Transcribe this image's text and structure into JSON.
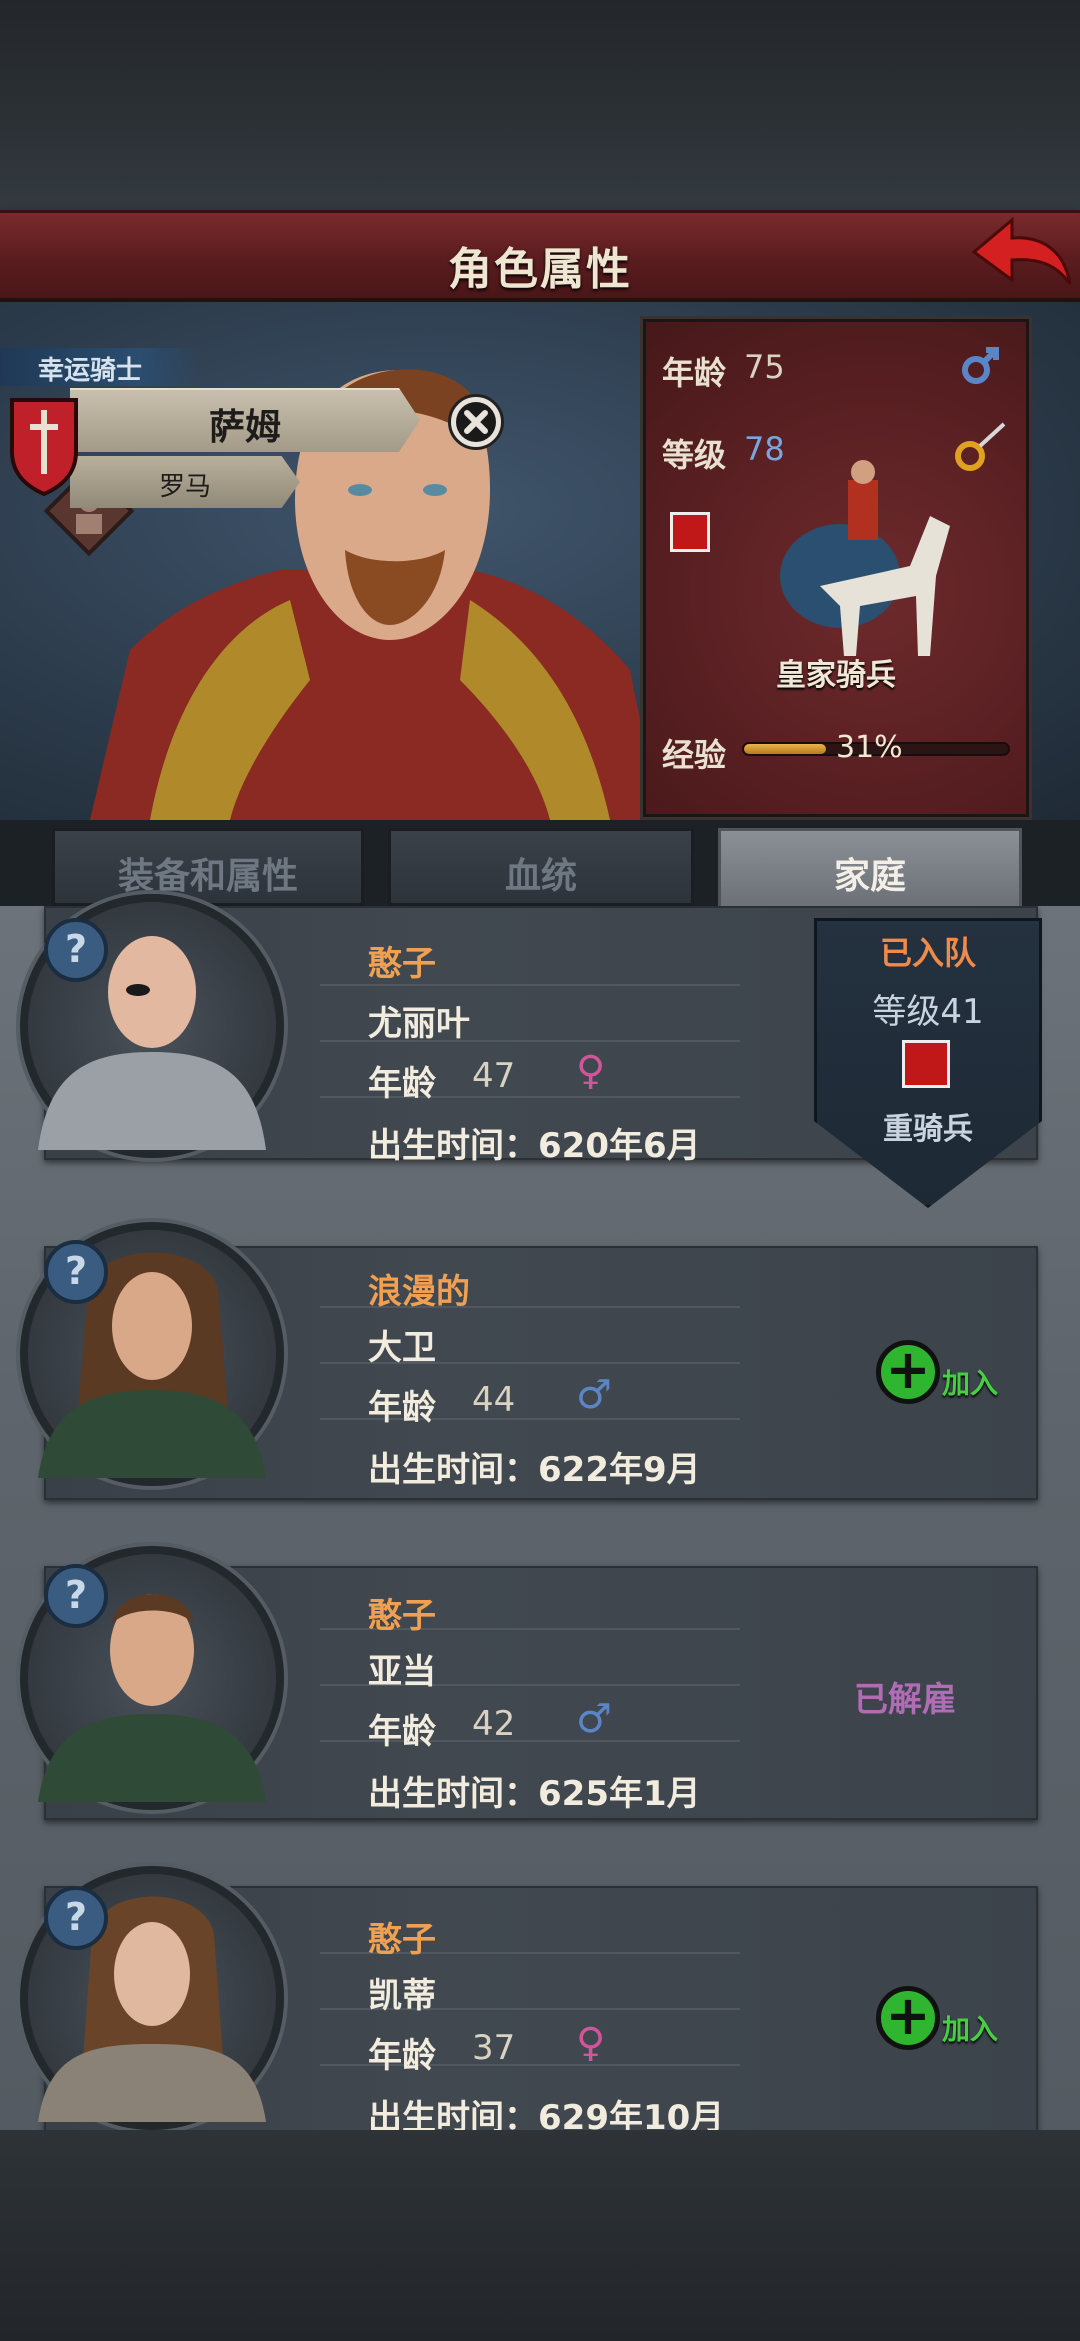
{
  "screen": {
    "title": "角色属性"
  },
  "hero": {
    "rank": "幸运骑士",
    "name": "萨姆",
    "origin": "罗马",
    "age_label": "年龄",
    "age": "75",
    "gender_icon": "male-icon",
    "level_label": "等级",
    "level": "78",
    "mount": "皇家骑兵",
    "exp_label": "经验",
    "exp_percent": "31%",
    "exp_fraction": 0.31
  },
  "tabs": [
    {
      "label": "装备和属性",
      "active": false
    },
    {
      "label": "血统",
      "active": false
    },
    {
      "label": "家庭",
      "active": true
    }
  ],
  "family": [
    {
      "trait": "憨子",
      "name": "尤丽叶",
      "age_label": "年龄",
      "age": "47",
      "gender": "♀",
      "birth": "出生时间：620年6月"
    },
    {
      "trait": "浪漫的",
      "name": "大卫",
      "age_label": "年龄",
      "age": "44",
      "gender": "♂",
      "birth": "出生时间：622年9月",
      "action": "加入"
    },
    {
      "trait": "憨子",
      "name": "亚当",
      "age_label": "年龄",
      "age": "42",
      "gender": "♂",
      "birth": "出生时间：625年1月",
      "status": "已解雇"
    },
    {
      "trait": "憨子",
      "name": "凯蒂",
      "age_label": "年龄",
      "age": "37",
      "gender": "♀",
      "birth": "出生时间：629年10月",
      "action": "加入"
    }
  ],
  "joined_banner": {
    "title": "已入队",
    "level": "等级41",
    "unit": "重骑兵"
  },
  "help_symbol": "?",
  "colors": {
    "title_bar": "#5a1c1f",
    "trait": "#f0a050",
    "male": "#5a86c8",
    "female": "#d0559a",
    "join": "#2fb52f",
    "fired": "#b06cb4"
  }
}
